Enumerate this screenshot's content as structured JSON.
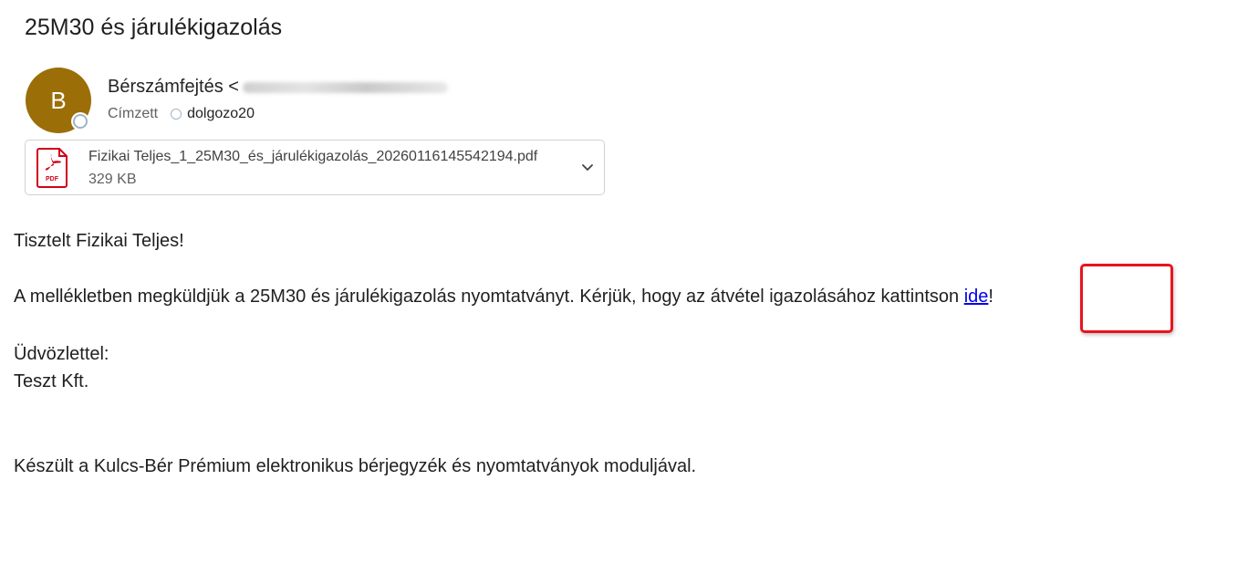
{
  "subject": "25M30 és járulékigazolás",
  "sender": {
    "avatar_initial": "B",
    "name": "Bérszámfejtés <",
    "email_visible_fragment": "",
    "to_label": "Címzett",
    "recipient": "dolgozo20"
  },
  "attachment": {
    "icon": "pdf-icon",
    "icon_label": "PDF",
    "file_name": "Fizikai Teljes_1_25M30_és_járulékigazolás_20260116145542194.pdf",
    "file_size": "329 KB"
  },
  "body": {
    "greeting": "Tisztelt Fizikai Teljes!",
    "main_before_link": "A mellékletben megküldjük a 25M30 és járulékigazolás nyomtatványt. Kérjük, hogy az átvétel igazolásához kattintson ",
    "link_text": "ide",
    "main_after_link": "!",
    "closing": "Üdvözlettel:",
    "signature": "Teszt Kft.",
    "footer": "Készült a Kulcs-Bér Prémium elektronikus bérjegyzék és nyomtatványok moduljával."
  },
  "colors": {
    "avatar_bg": "#9b6e08",
    "link": "#0000ee",
    "highlight_border": "#e8141c",
    "pdf_red": "#d0021b"
  }
}
